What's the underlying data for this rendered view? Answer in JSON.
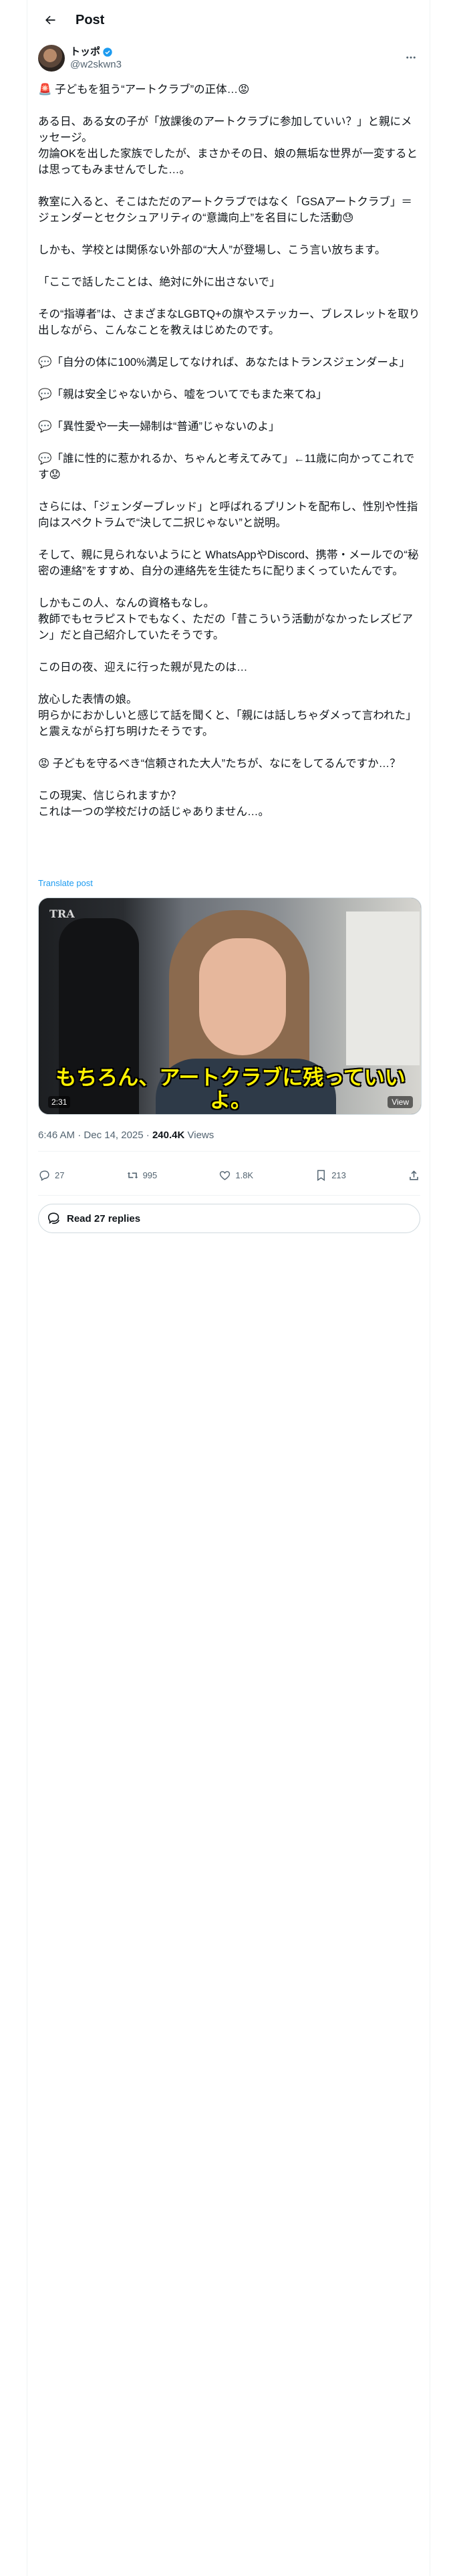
{
  "header": {
    "title": "Post"
  },
  "author": {
    "display_name": "トッポ",
    "handle": "@w2skwn3"
  },
  "post": {
    "paragraphs": [
      "🚨 子どもを狙う“アートクラブ”の正体…😡",
      "ある日、ある女の子が「放課後のアートクラブに参加していい？」と親にメッセージ。\n勿論OKを出した家族でしたが、まさかその日、娘の無垢な世界が一変するとは思ってもみませんでした…。",
      "教室に入ると、そこはただのアートクラブではなく「GSAアートクラブ」＝ジェンダーとセクシュアリティの“意識向上”を名目にした活動😓",
      "しかも、学校とは関係ない外部の“大人”が登場し、こう言い放ちます。",
      "「ここで話したことは、絶対に外に出さないで」",
      "その“指導者”は、さまざまなLGBTQ+の旗やステッカー、ブレスレットを取り出しながら、こんなことを教えはじめたのです。",
      "💬「自分の体に100%満足してなければ、あなたはトランスジェンダーよ」",
      "💬「親は安全じゃないから、嘘をついてでもまた来てね」",
      "💬「異性愛や一夫一婦制は“普通”じゃないのよ」",
      "💬「誰に性的に惹かれるか、ちゃんと考えてみて」←11歳に向かってこれです😟",
      "さらには、「ジェンダーブレッド」と呼ばれるプリントを配布し、性別や性指向はスペクトラムで“決して二択じゃない”と説明。",
      "そして、親に見られないようにと WhatsAppやDiscord、携帯・メールでの“秘密の連絡”をすすめ、自分の連絡先を生徒たちに配りまくっていたんです。",
      "しかもこの人、なんの資格もなし。\n教師でもセラピストでもなく、ただの「昔こういう活動がなかったレズビアン」だと自己紹介していたそうです。",
      "この日の夜、迎えに行った親が見たのは…",
      "放心した表情の娘。\n明らかにおかしいと感じて話を聞くと、「親には話しちゃダメって言われた」と震えながら打ち明けたそうです。",
      "😡 子どもを守るべき“信頼された大人”たちが、なにをしてるんですか…？",
      "この現実、信じられますか？\nこれは一つの学校だけの話じゃありません…。"
    ],
    "translate_label": "Translate post"
  },
  "video": {
    "logo": "TRA",
    "subtitle": "もちろん、アートクラブに残っていいよ。",
    "duration": "2:31",
    "views_label": "View"
  },
  "meta": {
    "time": "6:46 AM",
    "date": "Dec 14, 2025",
    "views_count": "240.4K",
    "views_label": "Views"
  },
  "actions": {
    "replies": "27",
    "reposts": "995",
    "likes": "1.8K",
    "bookmarks": "213"
  },
  "read_replies": {
    "label": "Read 27 replies"
  }
}
